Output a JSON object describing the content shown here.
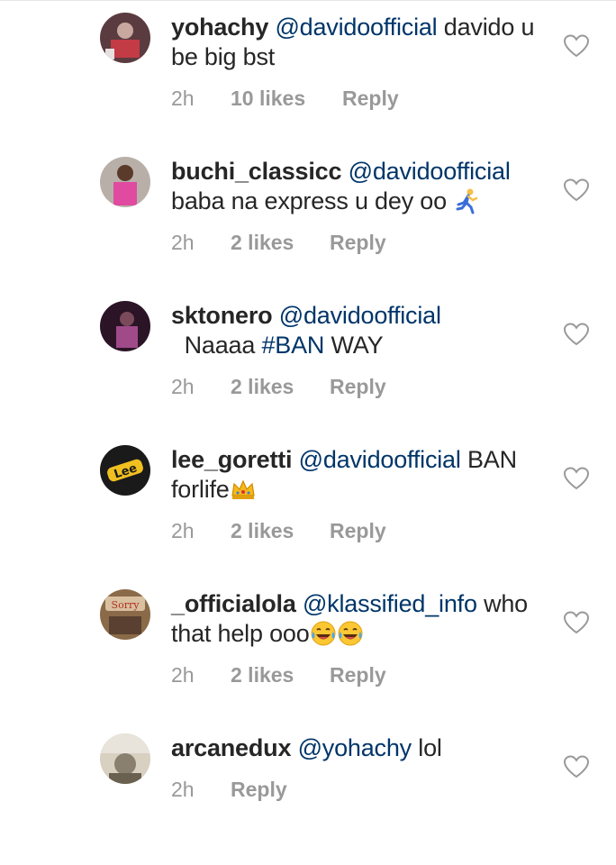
{
  "comments": [
    {
      "username": "yohachy",
      "mention": "@davidoofficial",
      "text": " davido u be big bst",
      "emoji": "",
      "time": "2h",
      "likes": "10 likes",
      "reply": "Reply"
    },
    {
      "username": "buchi_classicc",
      "mention": "@davidoofficial",
      "text": " baba na express u dey oo ",
      "emoji": "runner-emoji",
      "time": "2h",
      "likes": "2 likes",
      "reply": "Reply"
    },
    {
      "username": "sktonero",
      "mention": "@davidoofficial",
      "text": "  Naaaa ",
      "hashtag": "#BAN",
      "text2": " WAY",
      "time": "2h",
      "likes": "2 likes",
      "reply": "Reply"
    },
    {
      "username": "lee_goretti",
      "mention": "@davidoofficial",
      "text": " BAN forlife",
      "emoji": "crown-emoji",
      "time": "2h",
      "likes": "2 likes",
      "reply": "Reply"
    },
    {
      "username": "_officialola",
      "mention": "@klassified_info",
      "text": " who that help ooo",
      "emoji": "tears-of-joy-emoji",
      "time": "2h",
      "likes": "2 likes",
      "reply": "Reply"
    },
    {
      "username": "arcanedux",
      "mention": "@yohachy",
      "text": " lol",
      "emoji": "",
      "time": "2h",
      "likes": "",
      "reply": "Reply"
    }
  ],
  "colors": {
    "mention": "#003569",
    "meta": "#999999",
    "text": "#262626"
  }
}
